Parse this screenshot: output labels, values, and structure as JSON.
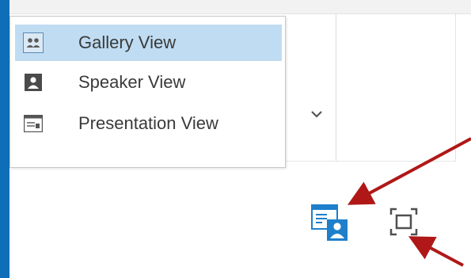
{
  "view_menu": {
    "items": [
      {
        "label": "Gallery View",
        "icon": "gallery-view-icon",
        "selected": true
      },
      {
        "label": "Speaker View",
        "icon": "speaker-view-icon",
        "selected": false
      },
      {
        "label": "Presentation View",
        "icon": "presentation-view-icon",
        "selected": false
      }
    ]
  },
  "toolbar": {
    "chevron_icon": "chevron-down-icon",
    "presenter_icon": "presenter-view-icon",
    "fullscreen_icon": "full-screen-icon"
  },
  "colors": {
    "accent": "#0e6eb8",
    "selection": "#bfdcf2",
    "arrow": "#b01818",
    "icon_blue": "#1e7fcb"
  }
}
